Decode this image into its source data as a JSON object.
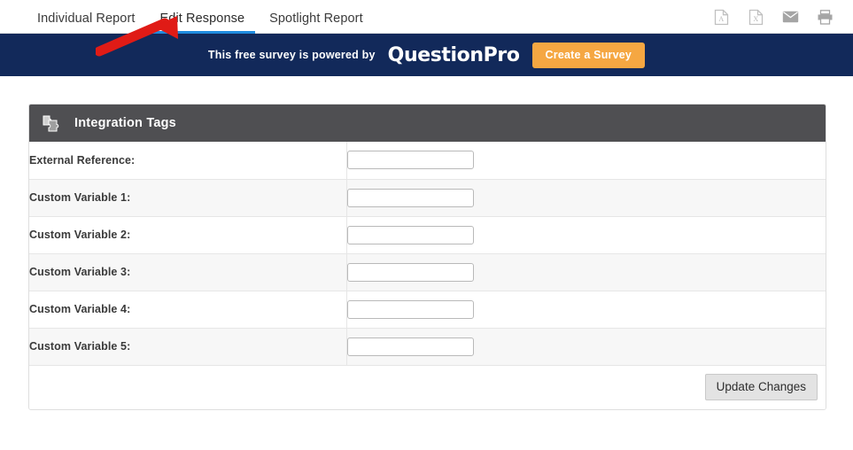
{
  "tabs": [
    {
      "label": "Individual Report",
      "active": false
    },
    {
      "label": "Edit Response",
      "active": true
    },
    {
      "label": "Spotlight Report",
      "active": false
    }
  ],
  "tab_icons": [
    {
      "name": "pdf-export-icon",
      "glyph": "A"
    },
    {
      "name": "excel-export-icon",
      "glyph": "X"
    },
    {
      "name": "email-icon",
      "glyph": "envelope"
    },
    {
      "name": "print-icon",
      "glyph": "printer"
    }
  ],
  "annotation": {
    "type": "red-arrow",
    "points_to": "Edit Response",
    "color": "#e01b16"
  },
  "banner": {
    "text": "This free survey is powered by",
    "logo": "QuestionPro",
    "cta_label": "Create a Survey",
    "background": "#12295a",
    "cta_background": "#f5a742"
  },
  "panel": {
    "title": "Integration Tags",
    "icon": "puzzle-tags-icon",
    "header_background": "#4f4f52",
    "rows": [
      {
        "label": "External Reference:",
        "value": "",
        "placeholder": ""
      },
      {
        "label": "Custom Variable 1:",
        "value": "",
        "placeholder": ""
      },
      {
        "label": "Custom Variable 2:",
        "value": "",
        "placeholder": ""
      },
      {
        "label": "Custom Variable 3:",
        "value": "",
        "placeholder": ""
      },
      {
        "label": "Custom Variable 4:",
        "value": "",
        "placeholder": ""
      },
      {
        "label": "Custom Variable 5:",
        "value": "",
        "placeholder": ""
      }
    ],
    "update_label": "Update Changes"
  }
}
